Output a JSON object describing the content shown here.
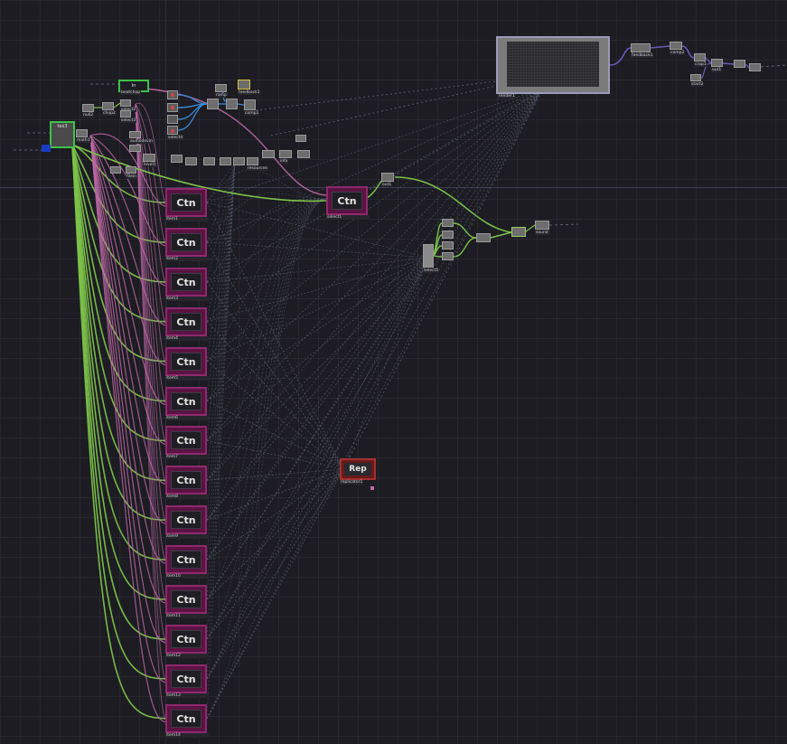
{
  "colors": {
    "background": "#1c1c22",
    "ctn_node": "#8d2a6c",
    "rep_node": "#a23030",
    "green_wire": "#7cc24a",
    "pink_wire": "#c06aa8",
    "blue_wire": "#3a8ad8",
    "purple_wire": "#6a5ab8",
    "dashed_link": "#5a5f70",
    "select_green": "#3ec24a"
  },
  "network": {
    "ctn_nodes": [
      {
        "title": "Ctn",
        "label": "item1"
      },
      {
        "title": "Ctn",
        "label": "item2"
      },
      {
        "title": "Ctn",
        "label": "item3"
      },
      {
        "title": "Ctn",
        "label": "item4"
      },
      {
        "title": "Ctn",
        "label": "item5"
      },
      {
        "title": "Ctn",
        "label": "item6"
      },
      {
        "title": "Ctn",
        "label": "item7"
      },
      {
        "title": "Ctn",
        "label": "item8"
      },
      {
        "title": "Ctn",
        "label": "item9"
      },
      {
        "title": "Ctn",
        "label": "item10"
      },
      {
        "title": "Ctn",
        "label": "item11"
      },
      {
        "title": "Ctn",
        "label": "item12"
      },
      {
        "title": "Ctn",
        "label": "item13"
      },
      {
        "title": "Ctn",
        "label": "item14"
      }
    ],
    "select_ctn": {
      "title": "Ctn",
      "label": "select1"
    },
    "rep_node": {
      "title": "Rep",
      "label": "replicator1"
    },
    "top_op": {
      "title": "In",
      "label": "beatchop"
    },
    "render_label": "render1",
    "small_ops": {
      "null2": "null2",
      "tex3": "tex3",
      "chop2": "chop2",
      "feedback1": "feedback1",
      "comp1": "comp1",
      "comp2": "comp2",
      "level1": "level1",
      "math1": "math1",
      "select2": "select2",
      "select3": "select3",
      "select4": "select4",
      "select5": "select5",
      "audio_in": "audiodevin",
      "file_in": "filein",
      "resources": "resources",
      "sound": "sound",
      "crop1": "crop1",
      "out1": "out1",
      "start2": "start2",
      "ramp": "ramp",
      "info": "info"
    }
  }
}
